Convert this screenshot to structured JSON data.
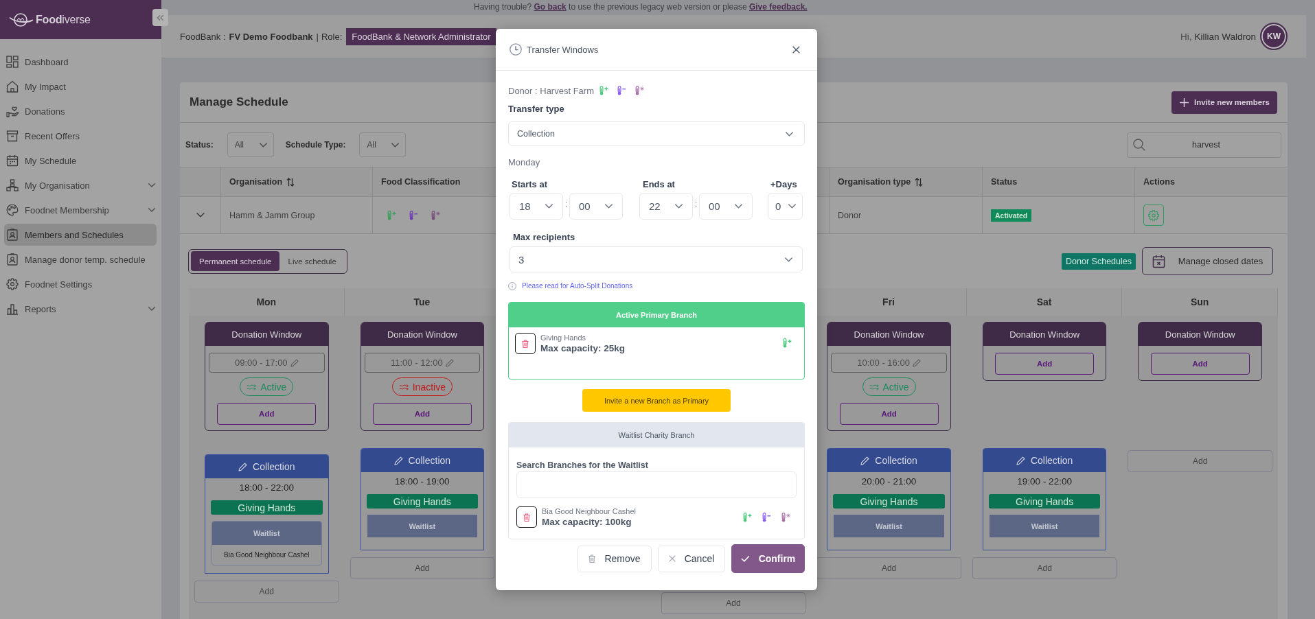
{
  "notice": {
    "parts": [
      {
        "kind": "text",
        "text": "Having trouble?"
      },
      {
        "kind": "link",
        "text": "Go back"
      },
      {
        "kind": "text",
        "text": "to use the previous legacy web version or please"
      },
      {
        "kind": "link",
        "text": "Give feedback."
      }
    ]
  },
  "sidebar": {
    "brand": "**Food**iverse",
    "items": [
      {
        "label": "Dashboard",
        "selected": false,
        "expandable": false
      },
      {
        "label": "My Impact",
        "selected": false,
        "expandable": false
      },
      {
        "label": "Donations",
        "selected": false,
        "expandable": false
      },
      {
        "label": "Recent Offers",
        "selected": false,
        "expandable": false
      },
      {
        "label": "My Schedule",
        "selected": false,
        "expandable": false
      },
      {
        "label": "My Organisation",
        "selected": false,
        "expandable": true
      },
      {
        "label": "Foodnet Membership",
        "selected": false,
        "expandable": true
      },
      {
        "label": "Members and Schedules",
        "selected": true,
        "expandable": false
      },
      {
        "label": "Manage donor temp. schedule",
        "selected": false,
        "expandable": false
      },
      {
        "label": "Foodnet Settings",
        "selected": false,
        "expandable": false
      },
      {
        "label": "Reports",
        "selected": false,
        "expandable": true
      }
    ]
  },
  "header": {
    "org_label": "FoodBank :",
    "org_name": "FV Demo Foodbank",
    "separator": "|",
    "role_label": "Role:",
    "role": "FoodBank & Network Administrator",
    "greeting": "Hi,",
    "user_name": "Killian Waldron",
    "avatar_initials": "KW"
  },
  "schedule": {
    "title": "Manage Schedule",
    "invite_button": "Invite new members",
    "filters": [
      {
        "label": "Status:",
        "value": "All"
      },
      {
        "label": "Schedule Type:",
        "value": "All"
      }
    ],
    "search": {
      "value": "harvest"
    },
    "table": {
      "columns": [
        {
          "label": "Organisation",
          "sortable": true
        },
        {
          "label": "Food Classification",
          "sortable": false
        },
        {
          "label": "Organisation type",
          "sortable": true
        },
        {
          "label": "Status",
          "sortable": false
        },
        {
          "label": "Actions",
          "sortable": false
        }
      ],
      "rows": [
        {
          "expanded": false,
          "organisation": "Hamm & Jamm Group",
          "food_classes": [
            {
              "kind": "ambient"
            },
            {
              "kind": "chilled"
            },
            {
              "kind": "frozen"
            }
          ],
          "organisation_type": "Donor",
          "status": "Activated"
        }
      ]
    },
    "views": [
      {
        "label": "Permanent schedule",
        "selected": true
      },
      {
        "label": "Live schedule",
        "selected": false
      }
    ],
    "donor_schedules_button": "Donor Schedules",
    "closed_dates_button": "Manage closed dates",
    "days_left": [
      {
        "label": "Mon",
        "donation_window": {
          "title": "Donation Window",
          "time": "09:00 - 17:00",
          "status": "Active",
          "active": true,
          "add_label": "Add"
        },
        "collections": [
          {
            "title": "Collection",
            "time": "18:00 - 22:00",
            "branch": "Giving Hands",
            "waitlist_title": "Waitlist",
            "waitlist": [
              "Bia Good Neighbour Cashel"
            ]
          }
        ],
        "add_label": "Add"
      },
      {
        "label": "Tue",
        "donation_window": {
          "title": "Donation Window",
          "time": "11:00 - 12:00",
          "status": "Inactive",
          "active": false,
          "add_label": "Add"
        },
        "collections": [
          {
            "title": "Collection",
            "time": "18:00 - 19:00",
            "branch": "Giving Hands",
            "waitlist_title": "Waitlist"
          }
        ],
        "add_label": "Add"
      }
    ],
    "days_right": [
      {
        "add_label": "Add"
      },
      {
        "label": "Fri",
        "donation_window": {
          "title": "Donation Window",
          "time": "10:00 - 16:00",
          "status": "Active",
          "active": true,
          "add_label": "Add"
        },
        "collections": [
          {
            "title": "Collection",
            "time": "20:00 - 21:00",
            "branch": "Giving Hands",
            "waitlist_title": "Waitlist"
          }
        ],
        "add_label": "Add"
      },
      {
        "label": "Sat",
        "donation_window": {
          "title": "Donation Window",
          "add_label": "Add"
        },
        "collections": [
          {
            "title": "Collection",
            "time": "19:00 - 22:00",
            "branch": "Giving Hands",
            "waitlist_title": "Waitlist"
          }
        ],
        "add_label": "Add"
      },
      {
        "label": "Sun",
        "donation_window": {
          "title": "Donation Window",
          "add_label": "Add"
        },
        "add_label": "Add"
      }
    ]
  },
  "modal": {
    "title": "Transfer Windows",
    "donor": "Donor : Harvest Farm",
    "donor_food_classes": [
      {
        "kind": "ambient"
      },
      {
        "kind": "chilled"
      },
      {
        "kind": "frozen"
      }
    ],
    "transfer_type_label": "Transfer type",
    "transfer_type": "Collection",
    "day": "Monday",
    "starts_label": "Starts at",
    "start_hour": "18",
    "start_separator": ":",
    "start_minute": "00",
    "ends_label": "Ends at",
    "end_hour": "22",
    "end_separator": ":",
    "end_minute": "00",
    "plus_days_label": "+Days",
    "plus_days": "0",
    "max_recipients_label": "Max recipients",
    "max_recipients": "3",
    "info_link": "Please read for Auto-Split Donations",
    "primary": {
      "title": "Active Primary Branch",
      "branches": [
        {
          "name": "Giving Hands",
          "capacity": "Max capacity: 25kg",
          "food_classes": [
            {
              "kind": "ambient"
            }
          ]
        }
      ]
    },
    "invite_primary_button": "Invite a new Branch as Primary",
    "waitlist": {
      "title": "Waitlist Charity Branch",
      "search_label": "Search Branches for the Waitlist",
      "branches": [
        {
          "name": "Bia Good Neighbour Cashel",
          "capacity": "Max capacity: 100kg",
          "food_classes": [
            {
              "kind": "ambient"
            },
            {
              "kind": "chilled"
            },
            {
              "kind": "frozen"
            }
          ]
        }
      ]
    },
    "buttons": [
      {
        "kind": "remove",
        "label": "Remove"
      },
      {
        "kind": "cancel",
        "label": "Cancel"
      },
      {
        "kind": "confirm",
        "label": "Confirm"
      }
    ]
  }
}
